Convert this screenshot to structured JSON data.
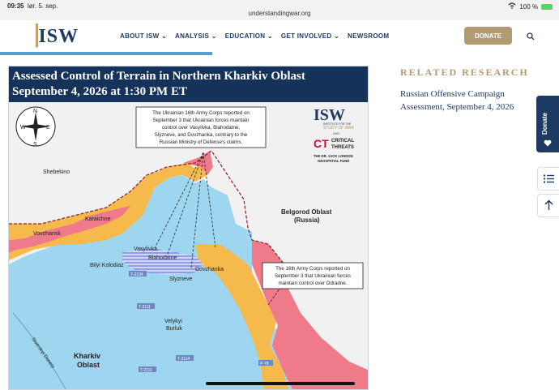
{
  "status_bar": {
    "time": "09:35",
    "date": "lør. 5. sep.",
    "url": "understandingwar.org",
    "battery": "100 %"
  },
  "nav": {
    "logo": "ISW",
    "items": [
      "ABOUT ISW",
      "ANALYSIS",
      "EDUCATION",
      "GET INVOLVED",
      "NEWSROOM"
    ],
    "donate_label": "DONATE"
  },
  "map": {
    "title_line1": "Assessed Control of Terrain in Northern Kharkiv Oblast",
    "title_line2": "September 4, 2026 at 1:30 PM ET",
    "compass": {
      "n": "N",
      "s": "S",
      "e": "E",
      "w": "W"
    },
    "logo": {
      "isw": "ISW",
      "isw_sub1": "INSTITUTE FOR THE",
      "isw_sub2": "STUDY OF WAR",
      "and": "AND",
      "ct_mark": "CT",
      "ct_line1": "CRITICAL",
      "ct_line2": "THREATS",
      "fund_line1": "THE DR. JACK LONDON",
      "fund_line2": "GEOSPATIAL FUND"
    },
    "callout1": [
      "The Ukrainian 16th Army Corps reported on",
      "September 3 that Ukrainian forces maintain",
      "control over Vasylivka, Blahodatne,",
      "Slyzneve, and Dovzhanka, contrary to the",
      "Russian Ministry of Defense's claims."
    ],
    "callout2": [
      "The 16th Army Corps reported on",
      "September 3 that Ukrainian forces",
      "maintain control over Odradne."
    ],
    "places": {
      "shebekino": "Shebekino",
      "belgorod1": "Belgorod Oblast",
      "belgorod2": "(Russia)",
      "karaichne": "Karaichne",
      "vovchansk": "Vovchansk",
      "vasylivka": "Vasylivka",
      "blahodatne": "Blahodatne",
      "bilyi": "Bilyi Kolodiaz",
      "dovzhanka": "Dovzhanka",
      "slyzneve": "Slyzneve",
      "velykyi1": "Velykyi",
      "velykyi2": "Burluk",
      "kharkiv1": "Kharkiv",
      "kharkiv2": "Oblast",
      "river": "Siverskyi Donets"
    },
    "roads": {
      "r1": "T-2104",
      "r2": "T-2111",
      "r3": "T-2114",
      "r4": "T-2111",
      "r5": "P-78"
    },
    "colors": {
      "ukraine": "#9ed6f0",
      "russia_control": "#ef7a8a",
      "russia_advance": "#f6b94c",
      "background": "#f1f1f1",
      "header": "#15325a"
    }
  },
  "sidebar": {
    "related_title": "RELATED RESEARCH",
    "related_link": "Russian Offensive Campaign Assessment, September 4, 2026",
    "donate_tab": "Donate"
  }
}
